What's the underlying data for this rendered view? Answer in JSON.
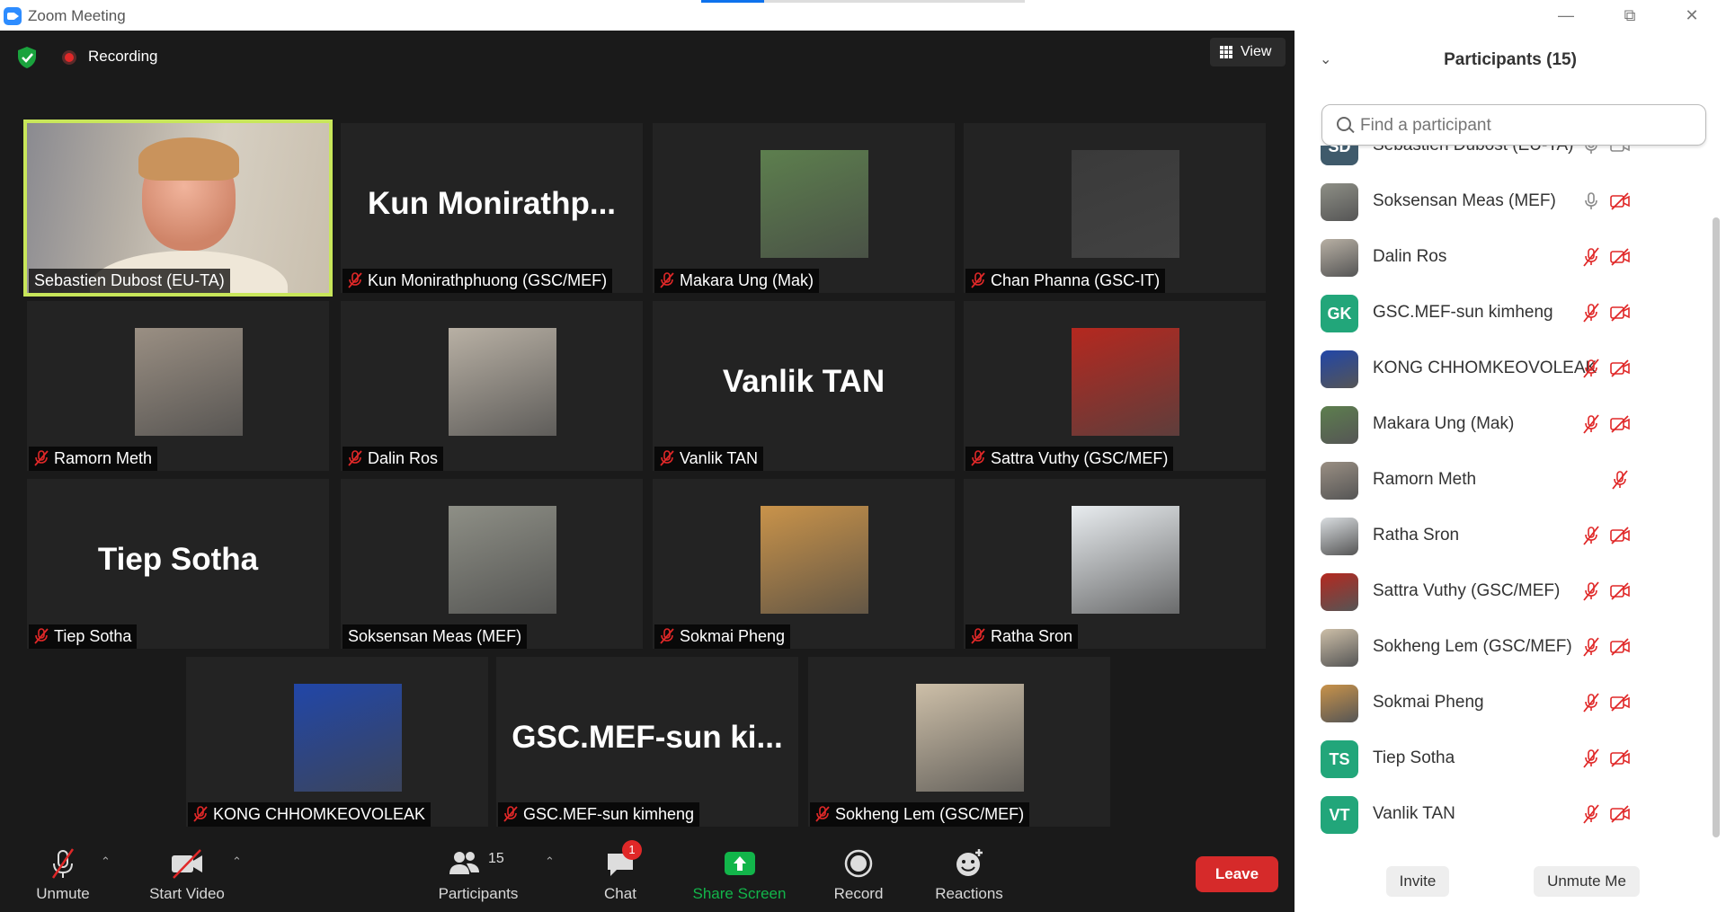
{
  "window": {
    "title": "Zoom Meeting"
  },
  "meeting": {
    "recording_label": "Recording",
    "view_label": "View",
    "tiles": [
      {
        "display": "video",
        "name": "Sebastien Dubost (EU-TA)",
        "muted": false,
        "active": true
      },
      {
        "display": "text",
        "big_text": "Kun  Monirathp...",
        "name": "Kun Monirathphuong (GSC/MEF)",
        "muted": true
      },
      {
        "display": "photo",
        "name": "Makara Ung (Mak)",
        "muted": true,
        "photo_color": "#5d7f4e"
      },
      {
        "display": "photo",
        "name": "Chan Phanna (GSC-IT)",
        "muted": true,
        "photo_color": "#3a3a3a"
      },
      {
        "display": "photo",
        "name": "Ramorn Meth",
        "muted": true,
        "photo_color": "#9a8f83"
      },
      {
        "display": "photo",
        "name": "Dalin Ros",
        "muted": true,
        "photo_color": "#b8b0a4"
      },
      {
        "display": "text",
        "big_text": "Vanlik TAN",
        "name": "Vanlik TAN",
        "muted": true
      },
      {
        "display": "photo",
        "name": "Sattra Vuthy (GSC/MEF)",
        "muted": true,
        "photo_color": "#b5281f"
      },
      {
        "display": "text",
        "big_text": "Tiep Sotha",
        "name": "Tiep Sotha",
        "muted": true
      },
      {
        "display": "photo",
        "name": "Soksensan Meas (MEF)",
        "muted": false,
        "photo_color": "#8e8f86"
      },
      {
        "display": "photo",
        "name": "Sokmai Pheng",
        "muted": true,
        "photo_color": "#c9934a"
      },
      {
        "display": "photo",
        "name": "Ratha Sron",
        "muted": true,
        "photo_color": "#e8ecef"
      },
      {
        "display": "photo",
        "name": "KONG CHHOMKEOVOLEAK",
        "muted": true,
        "photo_color": "#2146a8"
      },
      {
        "display": "text",
        "big_text": "GSC.MEF-sun  ki...",
        "name": "GSC.MEF-sun kimheng",
        "muted": true
      },
      {
        "display": "photo",
        "name": "Sokheng Lem (GSC/MEF)",
        "muted": true,
        "photo_color": "#cdbfa8"
      }
    ]
  },
  "toolbar": {
    "unmute": "Unmute",
    "start_video": "Start Video",
    "participants": "Participants",
    "participants_count": "15",
    "chat": "Chat",
    "chat_badge": "1",
    "share_screen": "Share Screen",
    "record": "Record",
    "reactions": "Reactions",
    "leave": "Leave"
  },
  "panel": {
    "title": "Participants (15)",
    "search_placeholder": "Find a participant",
    "invite": "Invite",
    "unmute_me": "Unmute Me",
    "participants": [
      {
        "name": "Sebastien Dubost (EU-TA)",
        "initials": "SD",
        "avatar_color": "#3f5a6b",
        "mic": "on",
        "video": "on"
      },
      {
        "name": "Soksensan Meas (MEF)",
        "initials": "",
        "avatar_color": "#8e8f86",
        "mic": "on",
        "video": "off"
      },
      {
        "name": "Dalin Ros",
        "initials": "",
        "avatar_color": "#b8b0a4",
        "mic": "off",
        "video": "off"
      },
      {
        "name": "GSC.MEF-sun kimheng",
        "initials": "GK",
        "avatar_color": "#22a67a",
        "mic": "off",
        "video": "off"
      },
      {
        "name": "KONG CHHOMKEOVOLEAK",
        "initials": "",
        "avatar_color": "#2146a8",
        "mic": "off",
        "video": "off"
      },
      {
        "name": "Makara Ung (Mak)",
        "initials": "",
        "avatar_color": "#5d7f4e",
        "mic": "off",
        "video": "off"
      },
      {
        "name": "Ramorn Meth",
        "initials": "",
        "avatar_color": "#9a8f83",
        "mic": "off",
        "video": "none"
      },
      {
        "name": "Ratha Sron",
        "initials": "",
        "avatar_color": "#d9dde0",
        "mic": "off",
        "video": "off"
      },
      {
        "name": "Sattra Vuthy (GSC/MEF)",
        "initials": "",
        "avatar_color": "#b5281f",
        "mic": "off",
        "video": "off"
      },
      {
        "name": "Sokheng Lem (GSC/MEF)",
        "initials": "",
        "avatar_color": "#cdbfa8",
        "mic": "off",
        "video": "off"
      },
      {
        "name": "Sokmai Pheng",
        "initials": "",
        "avatar_color": "#c9934a",
        "mic": "off",
        "video": "off"
      },
      {
        "name": "Tiep Sotha",
        "initials": "TS",
        "avatar_color": "#22a67a",
        "mic": "off",
        "video": "off"
      },
      {
        "name": "Vanlik TAN",
        "initials": "VT",
        "avatar_color": "#22a67a",
        "mic": "off",
        "video": "off"
      }
    ]
  },
  "colors": {
    "accent": "#0e72ed",
    "active_speaker": "#c8e65a",
    "leave": "#d62a2a",
    "muted_icon": "#e02828",
    "share_green": "#12b54a"
  }
}
